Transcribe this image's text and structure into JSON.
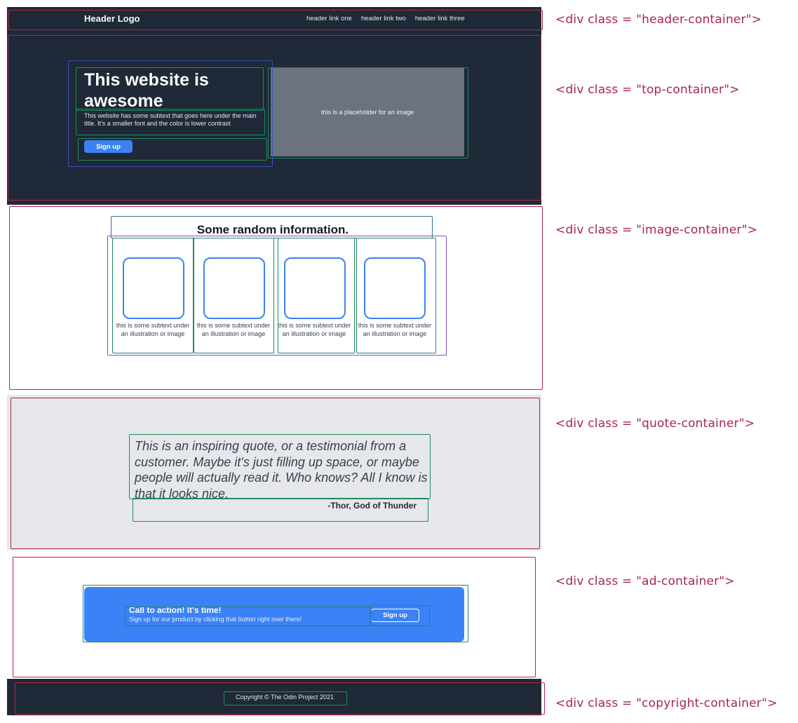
{
  "header": {
    "logo": "Header Logo",
    "links": [
      "header link one",
      "header link two",
      "header link three"
    ]
  },
  "hero": {
    "title": "This website is awesome",
    "subtext": "This website has some subtext that goes here under the main title.  It's a smaller font and the color is lower contrast",
    "button_label": "Sign up",
    "image_placeholder": "this is a placeholder for an image"
  },
  "info": {
    "title": "Some random information.",
    "cards": [
      {
        "text": "this is some subtext under an illustration or image"
      },
      {
        "text": "this is some subtext under an illustration or image"
      },
      {
        "text": "this is some subtext under an illustration or image"
      },
      {
        "text": "this is some subtext under an illustration or image"
      }
    ]
  },
  "quote": {
    "text": "This is an inspiring quote, or a testimonial from a customer.  Maybe it's just filling up space, or maybe people will actually read it. Who knows?  All I know is that it looks nice.",
    "author": "-Thor, God of Thunder"
  },
  "ad": {
    "title": "Call to action! It's time!",
    "subtext": "Sign up for our product by clicking that button right over there!",
    "button_label": "Sign up"
  },
  "footer": {
    "copyright": "Copyright  ©  The Odin Project 2021"
  },
  "annotations": [
    "<div class = \"header-container\">",
    "<div class = \"top-container\">",
    "<div class = \"image-container\">",
    "<div class = \"quote-container\">",
    "<div class = \"ad-container\">",
    "<div class = \"copyright-container\">"
  ]
}
